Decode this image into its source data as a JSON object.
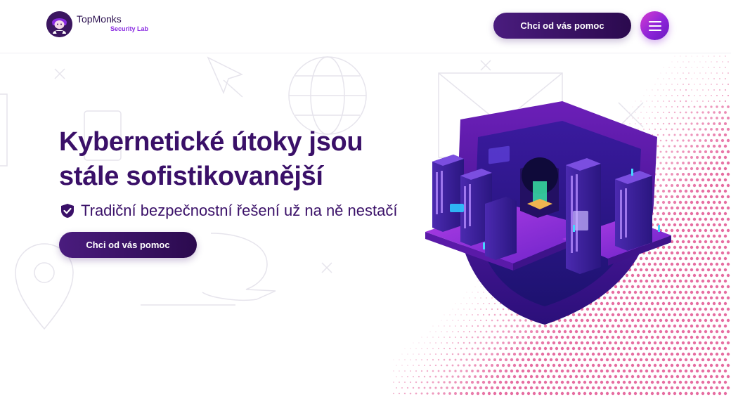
{
  "header": {
    "brand_name": "TopMonks",
    "brand_subtitle": "Security Lab",
    "cta_label": "Chci od vás pomoc",
    "menu_icon": "hamburger-icon"
  },
  "hero": {
    "title_line1": "Kybernetické útoky jsou",
    "title_line2": "stále sofistikovanější",
    "subtitle": "Tradiční bezpečnostní řešení už na ně nestačí",
    "subtitle_icon": "shield-check-icon",
    "cta_label": "Chci od vás pomoc"
  },
  "colors": {
    "primary": "#3a1068",
    "accent": "#8a2be2",
    "button_gradient_start": "#4a1c7e",
    "menu_gradient": "#d63bd0",
    "dots": "#e0488a"
  }
}
